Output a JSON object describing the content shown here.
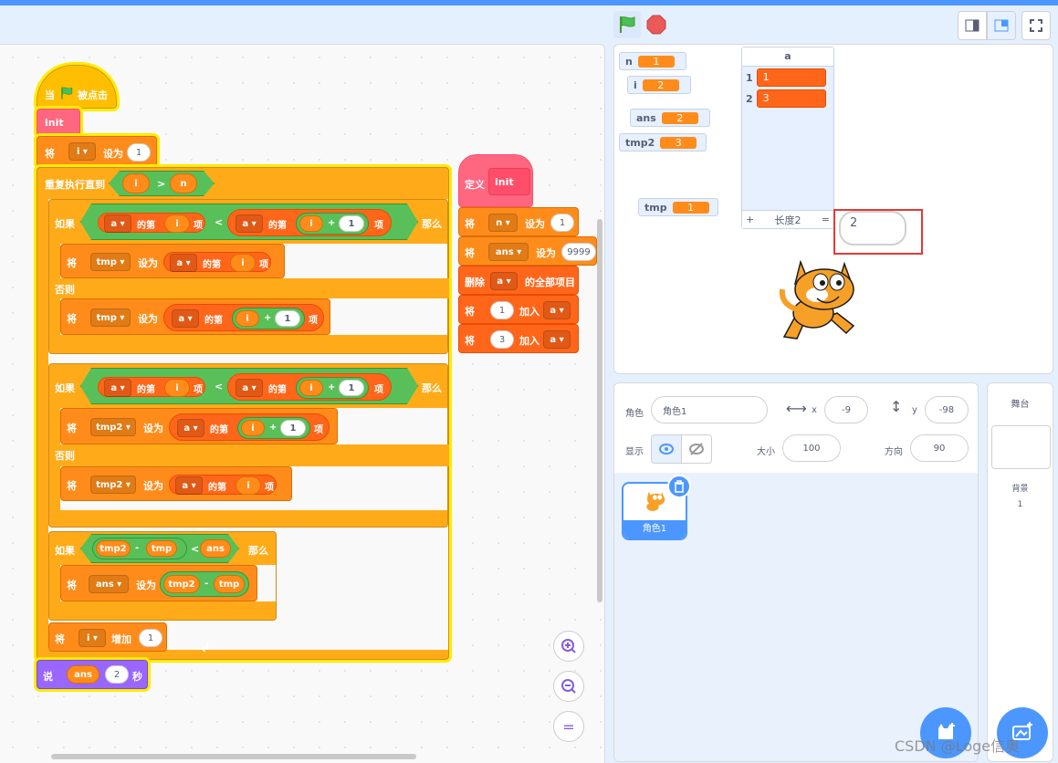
{
  "controls": {
    "flag_icon": "green-flag-icon",
    "stop_icon": "stop-sign-icon"
  },
  "script": {
    "hat": {
      "when": "当",
      "clicked": "被点击"
    },
    "init_call": "init",
    "set_i": {
      "verb": "将",
      "var": "i",
      "to": "设为",
      "value": "1"
    },
    "repeat_until": {
      "label": "重复执行直到",
      "left": "i",
      "op": ">",
      "right": "n"
    },
    "if1": {
      "label": "如果",
      "then": "那么",
      "list": "a",
      "item_of": "的第",
      "item": "项",
      "i": "i",
      "lt": "<",
      "plus": "+",
      "one": "1"
    },
    "if1_then": {
      "verb": "将",
      "var": "tmp",
      "to": "设为"
    },
    "else1": "否则",
    "if1_else": {
      "verb": "将",
      "var": "tmp",
      "to": "设为"
    },
    "if2_then": {
      "verb": "将",
      "var": "tmp2",
      "to": "设为"
    },
    "else2": "否则",
    "if2_else": {
      "verb": "将",
      "var": "tmp2",
      "to": "设为"
    },
    "if3": {
      "label": "如果",
      "then": "那么",
      "tmp2": "tmp2",
      "minus": "-",
      "tmp": "tmp",
      "lt": "<",
      "ans": "ans"
    },
    "if3_then": {
      "verb": "将",
      "var": "ans",
      "to": "设为"
    },
    "change_i": {
      "verb": "将",
      "var": "i",
      "by": "增加",
      "value": "1"
    },
    "say": {
      "label": "说",
      "var": "ans",
      "secs_value": "2",
      "secs": "秒"
    }
  },
  "define": {
    "label": "定义",
    "name": "init",
    "b1": {
      "verb": "将",
      "var": "n",
      "to": "设为",
      "value": "1"
    },
    "b2": {
      "verb": "将",
      "var": "ans",
      "to": "设为",
      "value": "9999"
    },
    "b3": {
      "verb": "删除",
      "list": "a",
      "rest": "的全部项目"
    },
    "b4": {
      "verb": "将",
      "value": "1",
      "add": "加入",
      "list": "a"
    },
    "b5": {
      "verb": "将",
      "value": "3",
      "add": "加入",
      "list": "a"
    }
  },
  "zoom": {
    "in": "zoom-in-icon",
    "out": "zoom-out-icon",
    "reset": "="
  },
  "monitors": {
    "n": {
      "name": "n",
      "value": "1"
    },
    "i": {
      "name": "i",
      "value": "2"
    },
    "ans": {
      "name": "ans",
      "value": "2"
    },
    "tmp2": {
      "name": "tmp2",
      "value": "3"
    },
    "tmp": {
      "name": "tmp",
      "value": "1"
    }
  },
  "list_monitor": {
    "name": "a",
    "items": [
      {
        "index": "1",
        "value": "1"
      },
      {
        "index": "2",
        "value": "3"
      }
    ],
    "add": "+",
    "length_label": "长度2",
    "equals": "="
  },
  "speech": "2",
  "sprite": {
    "sprite_label": "角色",
    "sprite_name": "角色1",
    "x_label": "x",
    "x": "-9",
    "y_label": "y",
    "y": "-98",
    "show_label": "显示",
    "size_label": "大小",
    "size": "100",
    "dir_label": "方向",
    "direction": "90",
    "thumb_name": "角色1"
  },
  "stage_panel": {
    "title": "舞台",
    "backdrop_label": "背景",
    "backdrop_count": "1"
  },
  "watermark": "CSDN @Loge信奥"
}
